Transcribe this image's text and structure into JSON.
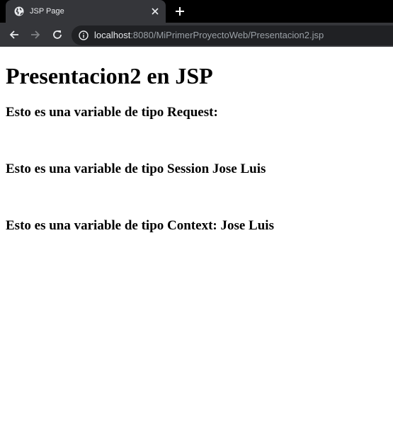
{
  "browser": {
    "tab_title": "JSP Page",
    "url_host": "localhost",
    "url_rest": ":8080/MiPrimerProyectoWeb/Presentacion2.jsp",
    "colors": {
      "tabstrip": "#000000",
      "toolbar": "#35363a",
      "omnibox": "#202124"
    }
  },
  "page": {
    "heading": "Presentacion2 en JSP",
    "request_line": "Esto es una variable de tipo Request:",
    "session_line": "Esto es una variable de tipo Session Jose Luis",
    "context_line": "Esto es una variable de tipo Context: Jose Luis"
  },
  "icons": [
    "globe-icon",
    "close-icon",
    "plus-icon",
    "back-arrow-icon",
    "forward-arrow-icon",
    "reload-icon",
    "info-icon"
  ]
}
